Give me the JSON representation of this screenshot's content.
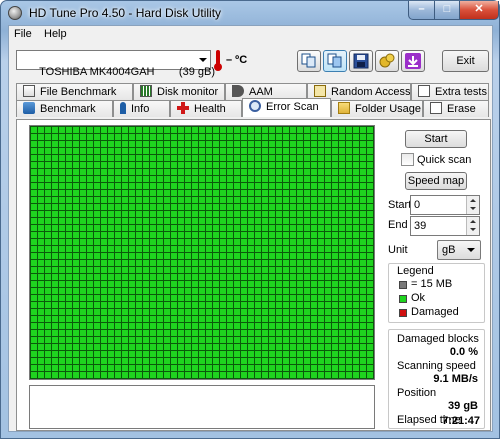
{
  "window": {
    "title": "HD Tune Pro 4.50 - Hard Disk Utility"
  },
  "menu": {
    "file_label": "File",
    "help_label": "Help"
  },
  "toolbar": {
    "drive": "TOSHIBA MK4004GAH        (39 gB)",
    "temperature": "– ºC",
    "exit_label": "Exit"
  },
  "tabs_top": [
    "File Benchmark",
    "Disk monitor",
    "AAM",
    "Random Access",
    "Extra tests"
  ],
  "tabs_bottom": [
    "Benchmark",
    "Info",
    "Health",
    "Error Scan",
    "Folder Usage",
    "Erase"
  ],
  "error_scan": {
    "start_label": "Start",
    "quick_scan_label": "Quick scan",
    "quick_scan_checked": false,
    "speed_map_label": "Speed map",
    "start_field_label": "Start",
    "start_value": "0",
    "end_field_label": "End",
    "end_value": "39",
    "unit_label": "Unit",
    "unit_value": "gB",
    "legend": {
      "title": "Legend",
      "block_size": "= 15 MB",
      "ok": "Ok",
      "damaged": "Damaged",
      "ok_color": "#1fd41f",
      "damaged_color": "#d01010",
      "block_color": "#7a7a7a"
    },
    "stats": {
      "damaged_blocks_label": "Damaged blocks",
      "damaged_blocks_value": "0.0 %",
      "scanning_speed_label": "Scanning speed",
      "scanning_speed_value": "9.1 MB/s",
      "position_label": "Position",
      "position_value": "39 gB",
      "elapsed_label": "Elapsed time",
      "elapsed_value": "7:21:47"
    }
  },
  "icons": [
    "hd-tune-app-icon",
    "thermometer-icon",
    "copy-icon",
    "copy-all-icon",
    "save-icon",
    "options-icon",
    "download-icon",
    "file-benchmark-icon",
    "disk-monitor-icon",
    "aam-speaker-icon",
    "random-access-icon",
    "extra-tests-icon",
    "benchmark-icon",
    "info-icon",
    "health-cross-icon",
    "magnifier-icon",
    "folder-icon",
    "erase-icon"
  ]
}
